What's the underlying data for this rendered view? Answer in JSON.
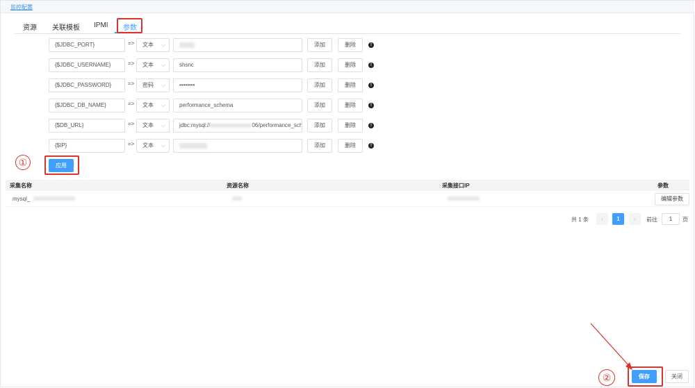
{
  "panel": {
    "title": "监控配置"
  },
  "tabs": [
    {
      "label": "资源"
    },
    {
      "label": "关联模板"
    },
    {
      "label": "IPMI"
    },
    {
      "label": "参数"
    }
  ],
  "params": [
    {
      "key": "{$JDBC_PORT}",
      "arrow": "=>",
      "type": "文本",
      "value": "",
      "add": "添加",
      "delete": "删除"
    },
    {
      "key": "{$JDBC_USERNAME}",
      "arrow": "=>",
      "type": "文本",
      "value": "shsnc",
      "add": "添加",
      "delete": "删除"
    },
    {
      "key": "{$JDBC_PASSWORD}",
      "arrow": "=>",
      "type": "密码",
      "value": "••••••••",
      "add": "添加",
      "delete": "删除"
    },
    {
      "key": "{$JDBC_DB_NAME}",
      "arrow": "=>",
      "type": "文本",
      "value": "performance_schema",
      "add": "添加",
      "delete": "删除"
    },
    {
      "key": "{$DB_URL}",
      "arrow": "=>",
      "type": "文本",
      "value_a": "jdbc:mysql://",
      "value_b": "06/performance_sch",
      "add": "添加",
      "delete": "删除"
    },
    {
      "key": "{$IP}",
      "arrow": "=>",
      "type": "文本",
      "value": "",
      "add": "添加",
      "delete": "删除"
    }
  ],
  "apply_label": "应用",
  "markers": {
    "one": "①",
    "two": "②"
  },
  "table": {
    "headers": [
      "采集名称",
      "资源名称",
      "采集接口IP",
      "参数"
    ],
    "rows": [
      {
        "name": "mysql_",
        "resource": "",
        "ip": "",
        "action": "编辑参数"
      }
    ]
  },
  "pagination": {
    "total": "共 1 条",
    "prev": "‹",
    "current": "1",
    "next": "›",
    "goto": "前往",
    "page_input": "1",
    "page_suffix": "页"
  },
  "footer": {
    "save_label": "保存",
    "close_label": "关闭"
  },
  "colors": {
    "primary": "#409eff",
    "annotation_red": "#d9342b"
  }
}
